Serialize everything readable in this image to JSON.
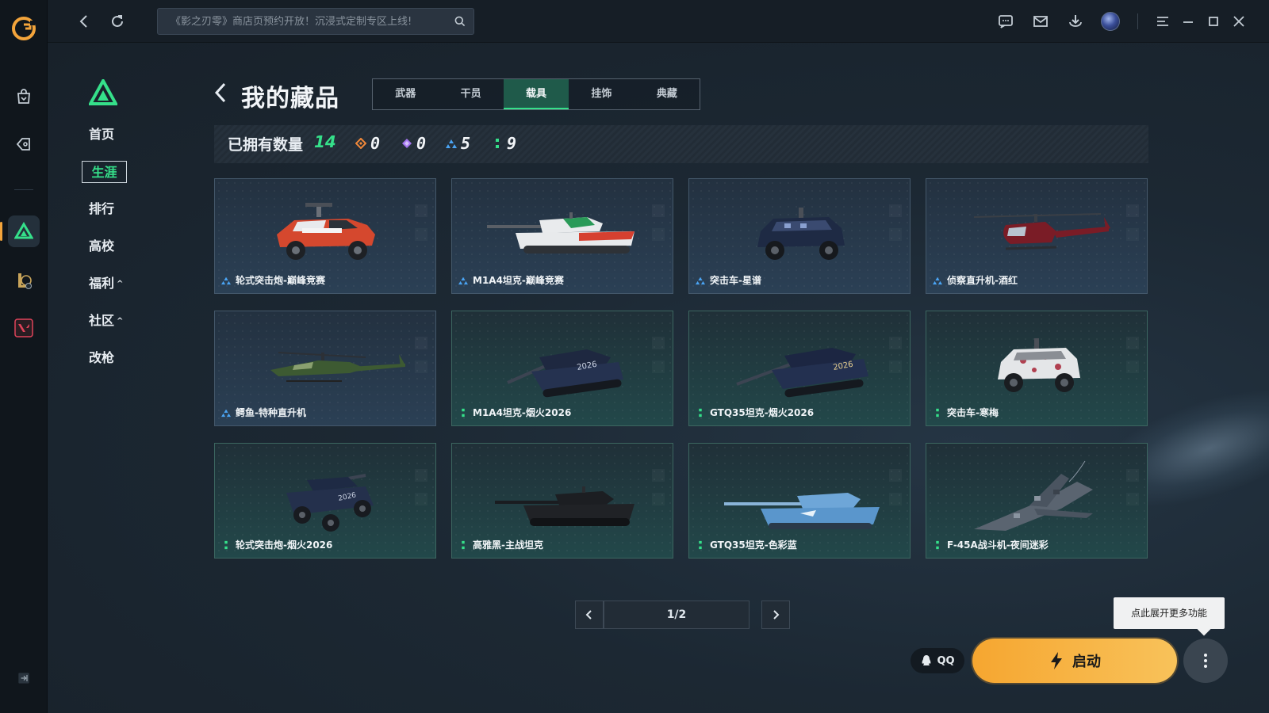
{
  "search": {
    "placeholder": "《影之刃零》商店页预约开放！沉浸式定制专区上线!"
  },
  "nav": {
    "items": [
      {
        "label": "首页"
      },
      {
        "label": "生涯"
      },
      {
        "label": "排行"
      },
      {
        "label": "高校"
      },
      {
        "label": "福利",
        "caret": "^"
      },
      {
        "label": "社区",
        "caret": "^"
      },
      {
        "label": "改枪"
      }
    ],
    "active": "生涯"
  },
  "page": {
    "title": "我的藏品"
  },
  "tabs": [
    "武器",
    "干员",
    "载具",
    "挂饰",
    "典藏"
  ],
  "active_tab": "载具",
  "owned": {
    "label": "已拥有数量",
    "count": "14",
    "rarity": [
      {
        "icon": "orange-diamond-icon",
        "color": "#f0883a",
        "value": "0"
      },
      {
        "icon": "purple-diamond-icon",
        "color": "#a576f0",
        "value": "0"
      },
      {
        "icon": "blue-triangle-icon",
        "color": "#4aa4f4",
        "value": "5"
      },
      {
        "icon": "green-dots-icon",
        "color": "#35e08a",
        "value": "9"
      }
    ]
  },
  "cards": [
    {
      "name": "轮式突击炮-巅峰竞赛",
      "rarity": "blue"
    },
    {
      "name": "M1A4坦克-巅峰竞赛",
      "rarity": "blue"
    },
    {
      "name": "突击车-星谱",
      "rarity": "blue"
    },
    {
      "name": "侦察直升机-酒红",
      "rarity": "blue"
    },
    {
      "name": "鳄鱼-特种直升机",
      "rarity": "blue"
    },
    {
      "name": "M1A4坦克-烟火2026",
      "rarity": "green"
    },
    {
      "name": "GTQ35坦克-烟火2026",
      "rarity": "green"
    },
    {
      "name": "突击车-寒梅",
      "rarity": "green"
    },
    {
      "name": "轮式突击炮-烟火2026",
      "rarity": "green"
    },
    {
      "name": "高雅黑-主战坦克",
      "rarity": "green"
    },
    {
      "name": "GTQ35坦克-色彩蓝",
      "rarity": "green"
    },
    {
      "name": "F-45A战斗机-夜间迷彩",
      "rarity": "green"
    }
  ],
  "pager": {
    "text": "1/2"
  },
  "tooltip": "点此展开更多功能",
  "qq_label": "QQ",
  "launch_label": "启动",
  "colors": {
    "accent_green": "#35e08a",
    "launch_orange": "#f6a630"
  }
}
